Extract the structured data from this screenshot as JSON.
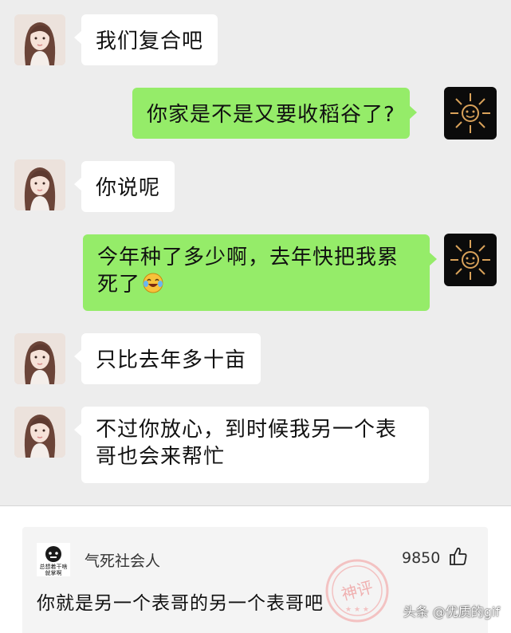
{
  "messages": [
    {
      "side": "in",
      "text": "我们复合吧"
    },
    {
      "side": "out",
      "text": "你家是不是又要收稻谷了?"
    },
    {
      "side": "in",
      "text": "你说呢"
    },
    {
      "side": "out",
      "line1": "今年种了多少啊，去年快把我累",
      "line2": "死了",
      "emoji": "laughing-crying-emoji"
    },
    {
      "side": "in",
      "text": "只比去年多十亩"
    },
    {
      "side": "in",
      "line1": "不过你放心，到时候我另一个表",
      "line2": "哥也会来帮忙"
    }
  ],
  "comment": {
    "avatar_caption_1": "总想着干啥",
    "avatar_caption_2": "就掌啊",
    "username": "气死社会人",
    "likes": "9850",
    "text": "你就是另一个表哥的另一个表哥吧",
    "stamp_text": "神评"
  },
  "watermark": "头条 @优质的gif",
  "colors": {
    "chat_bg": "#ededed",
    "outgoing_bubble": "#95ec69",
    "incoming_bubble": "#ffffff"
  }
}
